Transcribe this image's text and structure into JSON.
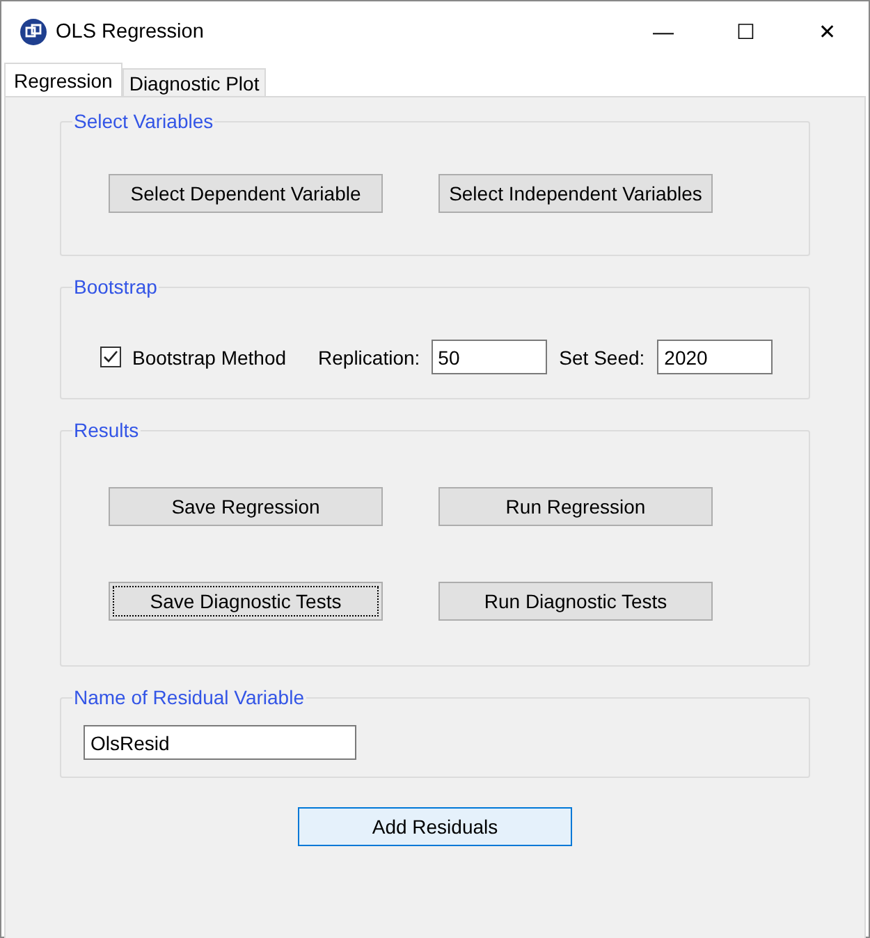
{
  "window": {
    "title": "OLS Regression",
    "controls": [
      "—",
      "☐",
      "✕"
    ]
  },
  "tabs": [
    {
      "label": "Regression",
      "selected": true
    },
    {
      "label": "Diagnostic Plot",
      "selected": false
    }
  ],
  "select_variables": {
    "title": "Select Variables",
    "buttons": [
      {
        "label": "Select Dependent Variable",
        "focused": false
      },
      {
        "label": "Select Independent Variables",
        "focused": false
      }
    ]
  },
  "bootstrap": {
    "title": "Bootstrap",
    "checkbox": {
      "label": "Bootstrap Method",
      "checked": true
    },
    "replication": {
      "label": "Replication:",
      "value": "50"
    },
    "seed": {
      "label": "Set Seed:",
      "value": "2020"
    }
  },
  "results": {
    "title": "Results",
    "buttons": [
      {
        "label": "Save Regression",
        "focused": false
      },
      {
        "label": "Run Regression",
        "focused": false
      },
      {
        "label": "Save Diagnostic Tests",
        "focused": true
      },
      {
        "label": "Run Diagnostic Tests",
        "focused": false
      }
    ]
  },
  "residual": {
    "title": "Name of Residual Variable",
    "value": "OlsResid"
  },
  "add_button": {
    "label": "Add Residuals",
    "highlighted": true
  }
}
